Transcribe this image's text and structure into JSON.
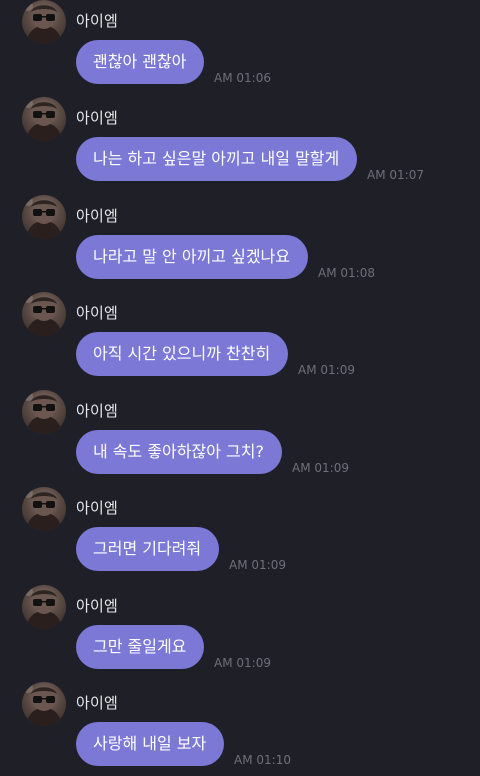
{
  "colors": {
    "background": "#1f1f27",
    "bubble": "#7b78d6",
    "bubble_text": "#ffffff",
    "sender_text": "#e6e6ea",
    "timestamp_text": "#6f6f79"
  },
  "messages": [
    {
      "sender": "아이엠",
      "text": "괜찮아 괜찮아",
      "time": "AM 01:06"
    },
    {
      "sender": "아이엠",
      "text": "나는 하고 싶은말 아끼고 내일 말할게",
      "time": "AM 01:07"
    },
    {
      "sender": "아이엠",
      "text": "나라고 말 안 아끼고 싶겠나요",
      "time": "AM 01:08"
    },
    {
      "sender": "아이엠",
      "text": "아직 시간 있으니까 찬찬히",
      "time": "AM 01:09"
    },
    {
      "sender": "아이엠",
      "text": "내 속도 좋아하잖아 그치?",
      "time": "AM 01:09"
    },
    {
      "sender": "아이엠",
      "text": "그러면 기다려줘",
      "time": "AM 01:09"
    },
    {
      "sender": "아이엠",
      "text": "그만 줄일게요",
      "time": "AM 01:09"
    },
    {
      "sender": "아이엠",
      "text": "사랑해 내일 보자",
      "time": "AM 01:10"
    }
  ]
}
